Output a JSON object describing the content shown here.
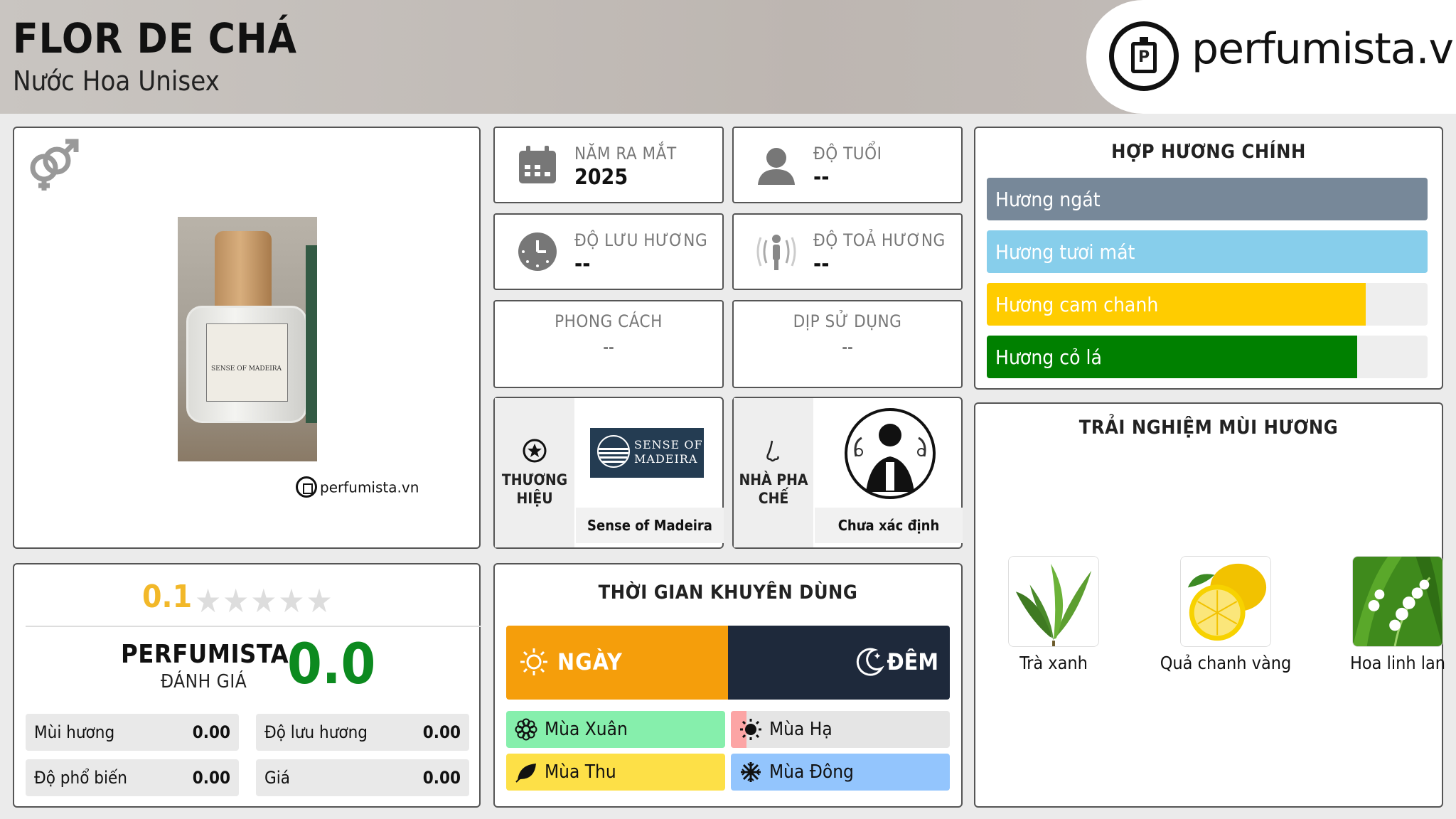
{
  "header": {
    "title": "FLOR DE CHÁ",
    "subtitle": "Nước Hoa Unisex",
    "logo_text": "perfumista.vn"
  },
  "product_image": {
    "watermark": "perfumista.vn",
    "bottle_label": "SENSE OF MADEIRA"
  },
  "info": {
    "launch_year_label": "NĂM RA MẮT",
    "launch_year_value": "2025",
    "age_label": "ĐỘ TUỔI",
    "age_value": "--",
    "longevity_label": "ĐỘ LƯU HƯƠNG",
    "longevity_value": "--",
    "sillage_label": "ĐỘ TOẢ HƯƠNG",
    "sillage_value": "--",
    "style_label": "PHONG CÁCH",
    "style_value": "--",
    "occasion_label": "DỊP SỬ DỤNG",
    "occasion_value": "--",
    "brand_label": "THƯƠNG HIỆU",
    "brand_name": "Sense of Madeira",
    "brand_logo_line1": "SENSE OF",
    "brand_logo_line2": "MADEIRA",
    "perfumer_label": "NHÀ PHA CHẾ",
    "perfumer_name": "Chưa xác định"
  },
  "accords": {
    "title": "HỢP HƯƠNG CHÍNH",
    "items": [
      {
        "label": "Hương ngát",
        "fill_pct": 100,
        "color": "#778899"
      },
      {
        "label": "Hương tươi mát",
        "fill_pct": 100,
        "color": "#87ceeb"
      },
      {
        "label": "Hương cam chanh",
        "fill_pct": 86,
        "color": "#ffcc00"
      },
      {
        "label": "Hương cỏ lá",
        "fill_pct": 84,
        "color": "#008000"
      }
    ]
  },
  "rating": {
    "average": "0.1",
    "star_fraction": 0.02,
    "perfumista_title": "PERFUMISTA",
    "perfumista_sub": "ĐÁNH GIÁ",
    "perfumista_score": "0.0",
    "metrics": [
      {
        "label": "Mùi hương",
        "value": "0.00"
      },
      {
        "label": "Độ lưu hương",
        "value": "0.00"
      },
      {
        "label": "Độ phổ biến",
        "value": "0.00"
      },
      {
        "label": "Giá",
        "value": "0.00"
      }
    ]
  },
  "time": {
    "title": "THỜI GIAN KHUYÊN DÙNG",
    "day_label": "NGÀY",
    "night_label": "ĐÊM",
    "day_fraction": 0.5,
    "seasons": [
      {
        "label": "Mùa Xuân",
        "color": "#86efac",
        "fill_pct": 100
      },
      {
        "label": "Mùa Hạ",
        "color": "#fca5a5",
        "fill_pct": 7
      },
      {
        "label": "Mùa Thu",
        "color": "#fde047",
        "fill_pct": 100
      },
      {
        "label": "Mùa Đông",
        "color": "#93c5fd",
        "fill_pct": 100
      }
    ]
  },
  "notes": {
    "title": "TRẢI NGHIỆM MÙI HƯƠNG",
    "items": [
      {
        "label": "Trà xanh"
      },
      {
        "label": "Quả chanh vàng"
      },
      {
        "label": "Hoa linh lan"
      }
    ]
  }
}
